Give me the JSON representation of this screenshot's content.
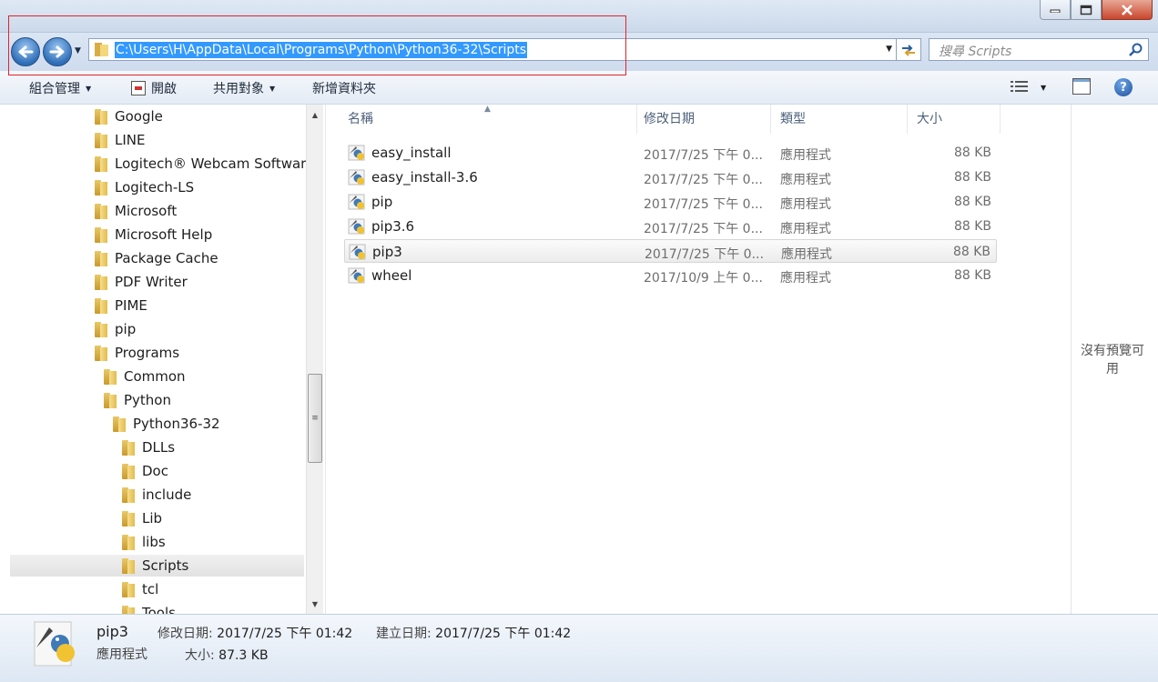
{
  "window": {
    "controls": [
      "minimize",
      "maximize",
      "close"
    ]
  },
  "address_bar": {
    "path": "C:\\Users\\H\\AppData\\Local\\Programs\\Python\\Python36-32\\Scripts",
    "search_placeholder": "搜尋 Scripts"
  },
  "toolbar": {
    "organize": "組合管理",
    "open": "開啟",
    "share": "共用對象",
    "new_folder": "新增資料夾"
  },
  "nav_tree": [
    {
      "label": "Google",
      "level": 0
    },
    {
      "label": "LINE",
      "level": 0
    },
    {
      "label": "Logitech® Webcam Software",
      "level": 0
    },
    {
      "label": "Logitech-LS",
      "level": 0
    },
    {
      "label": "Microsoft",
      "level": 0
    },
    {
      "label": "Microsoft Help",
      "level": 0
    },
    {
      "label": "Package Cache",
      "level": 0
    },
    {
      "label": "PDF Writer",
      "level": 0
    },
    {
      "label": "PIME",
      "level": 0
    },
    {
      "label": "pip",
      "level": 0
    },
    {
      "label": "Programs",
      "level": 0
    },
    {
      "label": "Common",
      "level": 1
    },
    {
      "label": "Python",
      "level": 1
    },
    {
      "label": "Python36-32",
      "level": 2
    },
    {
      "label": "DLLs",
      "level": 3
    },
    {
      "label": "Doc",
      "level": 3
    },
    {
      "label": "include",
      "level": 3
    },
    {
      "label": "Lib",
      "level": 3
    },
    {
      "label": "libs",
      "level": 3
    },
    {
      "label": "Scripts",
      "level": 3,
      "selected": true
    },
    {
      "label": "tcl",
      "level": 3
    },
    {
      "label": "Tools",
      "level": 3
    }
  ],
  "columns": {
    "name": "名稱",
    "date": "修改日期",
    "type": "類型",
    "size": "大小"
  },
  "files": [
    {
      "name": "easy_install",
      "date": "2017/7/25 下午 0...",
      "type": "應用程式",
      "size": "88 KB"
    },
    {
      "name": "easy_install-3.6",
      "date": "2017/7/25 下午 0...",
      "type": "應用程式",
      "size": "88 KB"
    },
    {
      "name": "pip",
      "date": "2017/7/25 下午 0...",
      "type": "應用程式",
      "size": "88 KB"
    },
    {
      "name": "pip3.6",
      "date": "2017/7/25 下午 0...",
      "type": "應用程式",
      "size": "88 KB"
    },
    {
      "name": "pip3",
      "date": "2017/7/25 下午 0...",
      "type": "應用程式",
      "size": "88 KB",
      "selected": true
    },
    {
      "name": "wheel",
      "date": "2017/10/9 上午 0...",
      "type": "應用程式",
      "size": "88 KB"
    }
  ],
  "preview": {
    "message": "沒有預覽可用"
  },
  "details": {
    "name": "pip3",
    "type": "應用程式",
    "modified_label": "修改日期:",
    "modified_value": "2017/7/25 下午 01:42",
    "created_label": "建立日期:",
    "created_value": "2017/7/25 下午 01:42",
    "size_label": "大小:",
    "size_value": "87.3 KB"
  },
  "colors": {
    "selection_blue": "#3399ff",
    "highlight_red": "#e0242c",
    "toolbar_bg": "#e3ebf5"
  }
}
